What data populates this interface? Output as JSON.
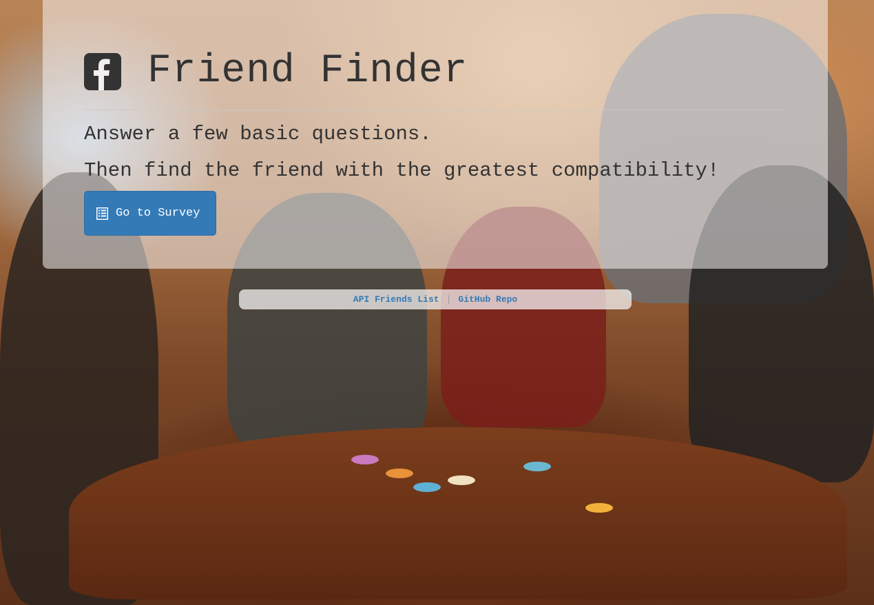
{
  "background": {
    "image_alt": "background-photo"
  },
  "jumbotron": {
    "icon": "facebook-square-icon",
    "title": "Friend Finder",
    "lead_line_1": "Answer a few basic questions.",
    "lead_line_2": "Then find the friend with the greatest compatibility!",
    "survey_button": {
      "icon": "list-alt-icon",
      "label": "Go to Survey"
    }
  },
  "footer": {
    "links": [
      {
        "label": "API Friends List"
      },
      {
        "label": "GitHub Repo"
      }
    ],
    "separator": "|"
  },
  "colors": {
    "primary_button": "#337ab7",
    "text": "#333333"
  }
}
